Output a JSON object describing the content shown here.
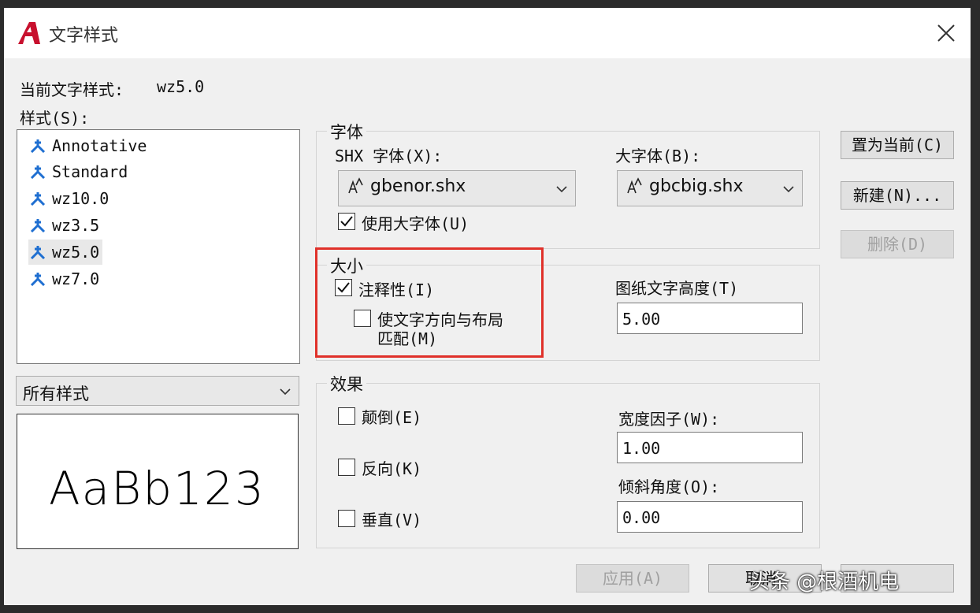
{
  "window": {
    "title": "文字样式",
    "icon": "autocad-logo-icon",
    "close": "close-icon"
  },
  "current_style": {
    "label": "当前文字样式:",
    "value": "wz5.0"
  },
  "styles": {
    "label": "样式(S):",
    "items": [
      "Annotative",
      "Standard",
      "wz10.0",
      "wz3.5",
      "wz5.0",
      "wz7.0"
    ],
    "selected": "wz5.0"
  },
  "filter": {
    "value": "所有样式"
  },
  "preview": {
    "text": "AaBb123"
  },
  "font": {
    "group_label": "字体",
    "shx_label": "SHX 字体(X):",
    "shx_value": "gbenor.shx",
    "big_label": "大字体(B):",
    "big_value": "gbcbig.shx",
    "use_big_font": "使用大字体(U)",
    "use_big_font_checked": true
  },
  "size": {
    "group_label": "大小",
    "annotative": "注释性(I)",
    "annotative_checked": true,
    "match_line1": "使文字方向与布局",
    "match_line2": "匹配(M)",
    "match_checked": false,
    "paper_height_label": "图纸文字高度(T)",
    "paper_height_value": "5.00"
  },
  "effects": {
    "group_label": "效果",
    "upside_down": "颠倒(E)",
    "backwards": "反向(K)",
    "vertical": "垂直(V)",
    "width_factor_label": "宽度因子(W):",
    "width_factor_value": "1.00",
    "oblique_label": "倾斜角度(O):",
    "oblique_value": "0.00"
  },
  "buttons": {
    "set_current": "置为当前(C)",
    "new": "新建(N)...",
    "delete": "删除(D)",
    "apply": "应用(A)",
    "cancel": "取消",
    "help": ""
  },
  "watermark": "头条 @根酒机电",
  "colors": {
    "highlight": "#e0312a",
    "style_icon": "#1f6fd1",
    "app_icon": "#c8102e"
  }
}
